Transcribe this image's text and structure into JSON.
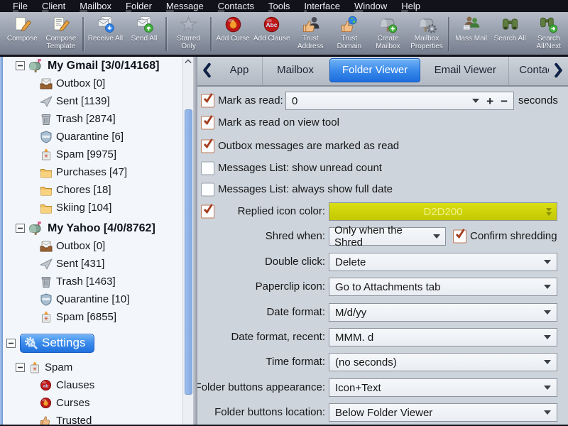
{
  "menu": {
    "items": [
      "File",
      "Client",
      "Mailbox",
      "Folder",
      "Message",
      "Contacts",
      "Tools",
      "Interface",
      "Window",
      "Help"
    ]
  },
  "toolbar": {
    "buttons": [
      {
        "label": "Compose"
      },
      {
        "label": "Compose Template"
      },
      {
        "label": "Receive All"
      },
      {
        "label": "Send All"
      },
      {
        "label": "Starred Only"
      },
      {
        "label": "Add Curse"
      },
      {
        "label": "Add Clause"
      },
      {
        "label": "Trust Address"
      },
      {
        "label": "Trust Domain"
      },
      {
        "label": "Create Mailbox"
      },
      {
        "label": "Mailbox Properties"
      },
      {
        "label": "Mass Mail"
      },
      {
        "label": "Search All"
      },
      {
        "label": "Search All/Next"
      }
    ]
  },
  "sidebar": {
    "items": [
      {
        "label": "My Gmail [3/0/14168]",
        "expanded": true
      },
      {
        "label": "Outbox [0]"
      },
      {
        "label": "Sent [1139]"
      },
      {
        "label": "Trash [2874]"
      },
      {
        "label": "Quarantine [6]"
      },
      {
        "label": "Spam [9975]"
      },
      {
        "label": "Purchases [47]"
      },
      {
        "label": "Chores [18]"
      },
      {
        "label": "Skiing [104]"
      },
      {
        "label": "My Yahoo [4/0/8762]",
        "expanded": true
      },
      {
        "label": "Outbox [0]"
      },
      {
        "label": "Sent [431]"
      },
      {
        "label": "Trash [1463]"
      },
      {
        "label": "Quarantine [10]"
      },
      {
        "label": "Spam [6855]"
      },
      {
        "label": "Settings",
        "selected": true,
        "expanded": true
      },
      {
        "label": "Spam",
        "expanded": true
      },
      {
        "label": "Clauses"
      },
      {
        "label": "Curses"
      },
      {
        "label": "Trusted"
      }
    ]
  },
  "tabs": {
    "items": [
      {
        "label": "App"
      },
      {
        "label": "Mailbox"
      },
      {
        "label": "Folder Viewer",
        "selected": true
      },
      {
        "label": "Email Viewer"
      },
      {
        "label": "Contacts"
      }
    ]
  },
  "form": {
    "mark_as_read": {
      "checked": true,
      "label": "Mark as read:",
      "value": "0",
      "unit": "seconds"
    },
    "mark_read_view": {
      "checked": true,
      "label": "Mark as read on view tool"
    },
    "outbox_read": {
      "checked": true,
      "label": "Outbox messages are marked as read"
    },
    "unread_count": {
      "checked": false,
      "label": "Messages List: show unread count"
    },
    "full_date": {
      "checked": false,
      "label": "Messages List: always show full date"
    },
    "replied_color": {
      "checked": true,
      "label": "Replied icon color:",
      "value": "D2D200",
      "swatch_color": "#d2d200"
    },
    "shred_when": {
      "label": "Shred when:",
      "value": "Only when the Shred",
      "confirm_checked": true,
      "confirm_label": "Confirm shredding"
    },
    "double_click": {
      "label": "Double click:",
      "value": "Delete"
    },
    "paperclip": {
      "label": "Paperclip icon:",
      "value": "Go to Attachments tab"
    },
    "date_format": {
      "label": "Date format:",
      "value": "M/d/yy"
    },
    "date_recent": {
      "label": "Date format, recent:",
      "value": "MMM. d"
    },
    "time_format": {
      "label": "Time format:",
      "value": "(no seconds)"
    },
    "fb_appearance": {
      "label": "Folder buttons appearance:",
      "value": "Icon+Text"
    },
    "fb_location": {
      "label": "Folder buttons location:",
      "value": "Below Folder Viewer"
    }
  }
}
